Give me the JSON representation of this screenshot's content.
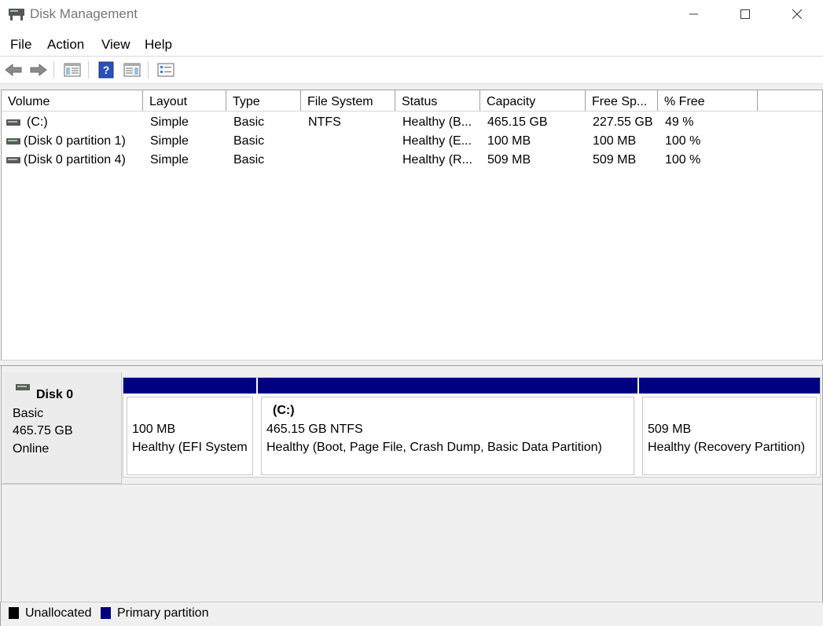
{
  "window": {
    "title": "Disk Management",
    "icon": "disk-management-icon",
    "controls": [
      "minimize-icon",
      "maximize-icon",
      "close-icon"
    ]
  },
  "menu": {
    "file": "File",
    "action": "Action",
    "view": "View",
    "help": "Help"
  },
  "toolbar": {
    "icons": [
      "back-arrow-icon",
      "forward-arrow-icon",
      "show-hide-console-tree-icon",
      "help-icon",
      "show-hide-action-pane-icon",
      "properties-icon"
    ]
  },
  "volume_list": {
    "columns": [
      "Volume",
      "Layout",
      "Type",
      "File System",
      "Status",
      "Capacity",
      "Free Sp...",
      "% Free"
    ],
    "rows": [
      {
        "volume": "(C:)",
        "layout": "Simple",
        "type": "Basic",
        "fs": "NTFS",
        "status": "Healthy (B...",
        "capacity": "465.15 GB",
        "free": "227.55 GB",
        "pct": "49 %"
      },
      {
        "volume": "(Disk 0 partition 1)",
        "layout": "Simple",
        "type": "Basic",
        "fs": "",
        "status": "Healthy (E...",
        "capacity": "100 MB",
        "free": "100 MB",
        "pct": "100 %"
      },
      {
        "volume": "(Disk 0 partition 4)",
        "layout": "Simple",
        "type": "Basic",
        "fs": "",
        "status": "Healthy (R...",
        "capacity": "509 MB",
        "free": "509 MB",
        "pct": "100 %"
      }
    ]
  },
  "disk": {
    "name": "Disk 0",
    "type": "Basic",
    "size": "465.75 GB",
    "state": "Online",
    "partitions": [
      {
        "title": "",
        "size": "100 MB",
        "status": "Healthy (EFI System"
      },
      {
        "title": "(C:)",
        "size": "465.15 GB NTFS",
        "status": "Healthy (Boot, Page File, Crash Dump, Basic Data Partition)"
      },
      {
        "title": "",
        "size": "509 MB",
        "status": "Healthy (Recovery Partition)"
      }
    ]
  },
  "legend": {
    "unallocated": "Unallocated",
    "primary": "Primary partition",
    "colors": {
      "unallocated": "#000000",
      "primary": "#000080"
    }
  }
}
